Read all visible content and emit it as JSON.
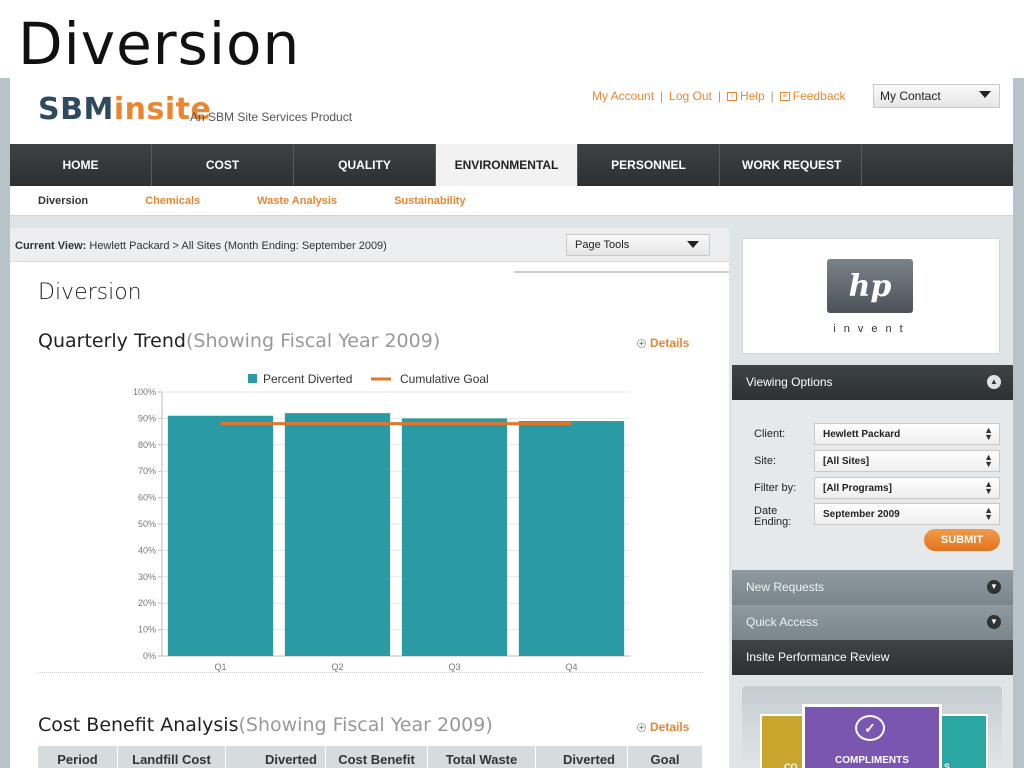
{
  "slide_title": "Diversion",
  "brand": {
    "logo_dark": "SBM",
    "logo_accent": "insite",
    "tagline": "An SBM Site Services Product"
  },
  "util_links": {
    "my_account": "My Account",
    "log_out": "Log Out",
    "help": "Help",
    "feedback": "Feedback",
    "sep": "|"
  },
  "contact_select": {
    "value": "My Contact"
  },
  "main_nav": [
    "HOME",
    "COST",
    "QUALITY",
    "ENVIRONMENTAL",
    "PERSONNEL",
    "WORK REQUEST"
  ],
  "sub_nav": [
    "Diversion",
    "Chemicals",
    "Waste Analysis",
    "Sustainability"
  ],
  "current_view": {
    "label": "Current View:",
    "value": "Hewlett Packard > All Sites (Month Ending: September 2009)"
  },
  "page_tools": "Page Tools",
  "page_title": "Diversion",
  "quarterly": {
    "title": "Quarterly Trend",
    "subtitle": "(Showing Fiscal Year 2009)",
    "details": "Details"
  },
  "cost_benefit": {
    "title": "Cost Benefit Analysis",
    "subtitle": "(Showing Fiscal Year 2009)",
    "details": "Details",
    "columns": [
      "Period",
      "Landfill Cost",
      "Diverted",
      "Cost Benefit",
      "Total Waste",
      "Diverted",
      "Goal"
    ]
  },
  "chart_data": {
    "type": "bar",
    "categories": [
      "Q1",
      "Q2",
      "Q3",
      "Q4"
    ],
    "series": [
      {
        "name": "Percent Diverted",
        "kind": "bar",
        "values": [
          91,
          92,
          90,
          89
        ]
      },
      {
        "name": "Cumulative Goal",
        "kind": "line",
        "values": [
          88,
          88,
          88,
          88
        ]
      }
    ],
    "yticks": [
      "0%",
      "10%",
      "20%",
      "30%",
      "40%",
      "50%",
      "60%",
      "70%",
      "80%",
      "90%",
      "100%"
    ],
    "ylim": [
      0,
      100
    ],
    "legend": "top",
    "grid": true,
    "colors": {
      "bar": "#2a9aa5",
      "goal": "#e2762a"
    }
  },
  "brand_logo": {
    "mark": "hp",
    "word": "invent"
  },
  "viewing_options": {
    "title": "Viewing Options",
    "rows": [
      {
        "label": "Client:",
        "value": "Hewlett Packard"
      },
      {
        "label": "Site:",
        "value": "[All Sites]"
      },
      {
        "label": "Filter by:",
        "value": "[All Programs]"
      },
      {
        "label": "Date Ending:",
        "value": "September 2009"
      }
    ],
    "submit": "SUBMIT"
  },
  "panels": {
    "new_requests": "New Requests",
    "quick_access": "Quick Access",
    "performance_review": "Insite Performance Review"
  },
  "promo": {
    "center": "COMPLIMENTS",
    "left_partial": "CO",
    "right_partial": "S"
  },
  "colors": {
    "accent": "#e9862e",
    "nav_dark": "#2c3033",
    "teal": "#2a9aa5"
  }
}
